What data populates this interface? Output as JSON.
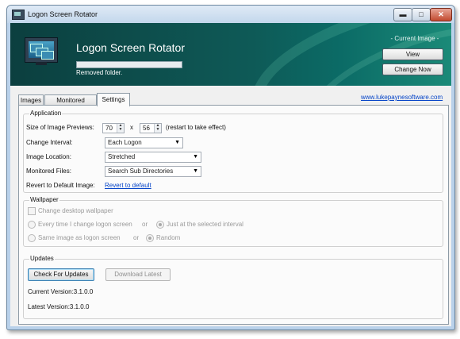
{
  "window": {
    "title": "Logon Screen Rotator",
    "controls": {
      "minimize": "▬",
      "maximize": "□",
      "close": "✕"
    }
  },
  "header": {
    "app_title": "Logon Screen Rotator",
    "progress_percent": 0,
    "status_text": "Removed folder.",
    "current_image_label": "- Current Image -",
    "view_button": "View",
    "change_now_button": "Change Now"
  },
  "tabs": [
    {
      "label": "Images"
    },
    {
      "label": "Monitored Folders"
    },
    {
      "label": "Settings",
      "selected": true
    }
  ],
  "website_link": "www.lukepaynesoftware.com",
  "application": {
    "group_title": "Application",
    "preview_size_label": "Size of Image Previews:",
    "preview_width": "70",
    "preview_x": "x",
    "preview_height": "56",
    "preview_note": "(restart to take effect)",
    "change_interval_label": "Change Interval:",
    "change_interval_value": "Each Logon",
    "image_location_label": "Image Location:",
    "image_location_value": "Stretched",
    "monitored_files_label": "Monitored Files:",
    "monitored_files_value": "Search Sub Directories",
    "revert_label": "Revert to Default Image:",
    "revert_link": "Revert to default"
  },
  "wallpaper": {
    "group_title": "Wallpaper",
    "change_desktop_label": "Change desktop wallpaper",
    "change_desktop_checked": false,
    "option_every_time": "Every time I change logon screen",
    "or1": "or",
    "option_selected_interval": "Just at the selected interval",
    "option_same_image": "Same image as logon screen",
    "or2": "or",
    "option_random": "Random"
  },
  "updates": {
    "group_title": "Updates",
    "check_button": "Check For Updates",
    "download_button": "Download Latest",
    "current_version": "Current Version:3.1.0.0",
    "latest_version": "Latest Version:3.1.0.0"
  }
}
